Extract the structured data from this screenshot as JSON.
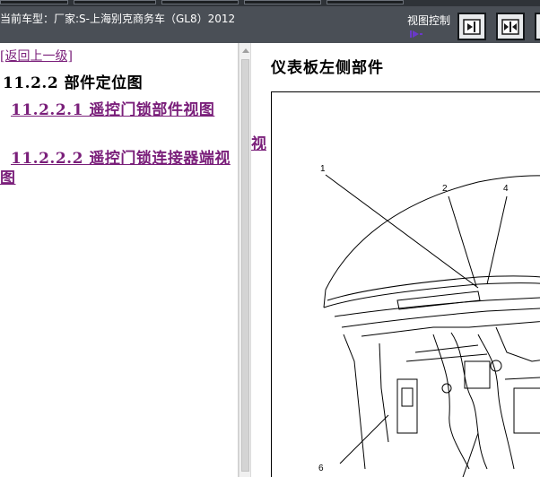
{
  "topbar": {
    "vehicle_label": "当前车型：厂家:S-上海别克商务车（GL8）2012",
    "view_control_label": "视图控制",
    "buttons": [
      {
        "name": "right-pane-button"
      },
      {
        "name": "split-pane-button"
      }
    ]
  },
  "left_panel": {
    "back_link": "[返回上一级]",
    "section_title": "11.2.2  部件定位图",
    "toc": [
      {
        "label": "11.2.2.1 遥控门锁部件视图"
      },
      {
        "label": "11.2.2.2 遥控门锁连接器端视图"
      }
    ]
  },
  "right_panel": {
    "overflow_char": "视",
    "figure_title": "仪表板左侧部件",
    "callouts": [
      "1",
      "2",
      "4",
      "6"
    ]
  }
}
